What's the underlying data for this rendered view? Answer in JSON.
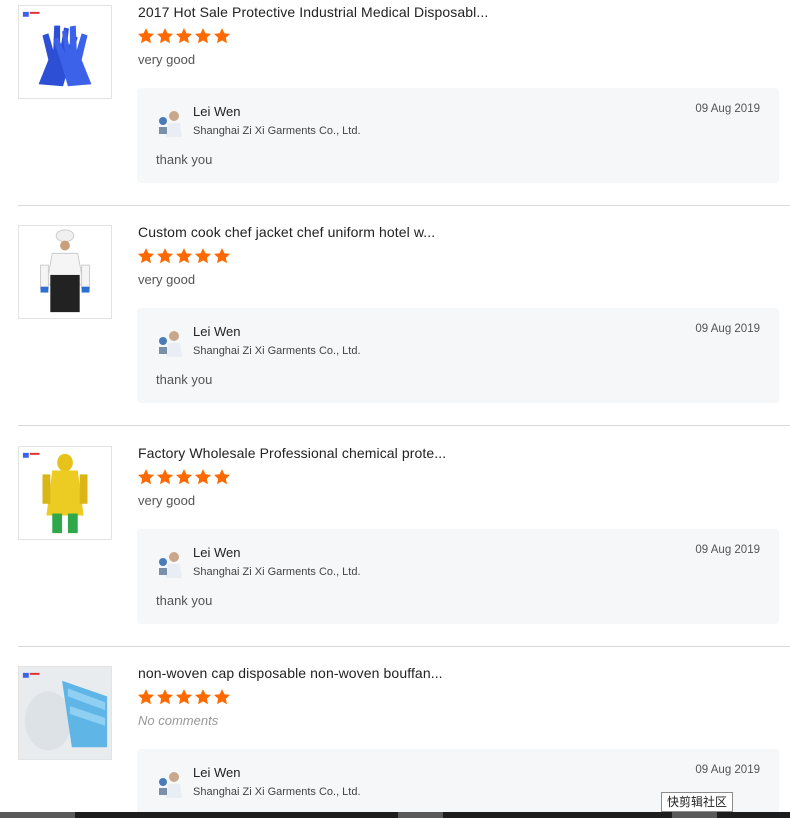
{
  "reviews": [
    {
      "product_title": "2017 Hot Sale Protective Industrial Medical Disposabl...",
      "rating": 5,
      "comment": "very good",
      "has_comment": true,
      "reply": {
        "name": "Lei Wen",
        "company": "Shanghai Zi Xi Garments Co., Ltd.",
        "date": "09 Aug 2019",
        "text": "thank you"
      }
    },
    {
      "product_title": "Custom cook chef jacket chef uniform hotel w...",
      "rating": 5,
      "comment": "very good",
      "has_comment": true,
      "reply": {
        "name": "Lei Wen",
        "company": "Shanghai Zi Xi Garments Co., Ltd.",
        "date": "09 Aug 2019",
        "text": "thank you"
      }
    },
    {
      "product_title": "Factory Wholesale Professional chemical prote...",
      "rating": 5,
      "comment": "very good",
      "has_comment": true,
      "reply": {
        "name": "Lei Wen",
        "company": "Shanghai Zi Xi Garments Co., Ltd.",
        "date": "09 Aug 2019",
        "text": "thank you"
      }
    },
    {
      "product_title": "non-woven cap disposable non-woven bouffan...",
      "rating": 5,
      "comment": "No comments",
      "has_comment": false,
      "reply": {
        "name": "Lei Wen",
        "company": "Shanghai Zi Xi Garments Co., Ltd.",
        "date": "09 Aug 2019",
        "text": ""
      }
    }
  ],
  "overlay_label": "快剪辑社区",
  "colors": {
    "star": "#ff6a00",
    "reply_bg": "#f6f7f9",
    "divider": "#d9d9d9"
  },
  "icons": [
    "star-icon",
    "product-thumbnail",
    "seller-avatar"
  ]
}
